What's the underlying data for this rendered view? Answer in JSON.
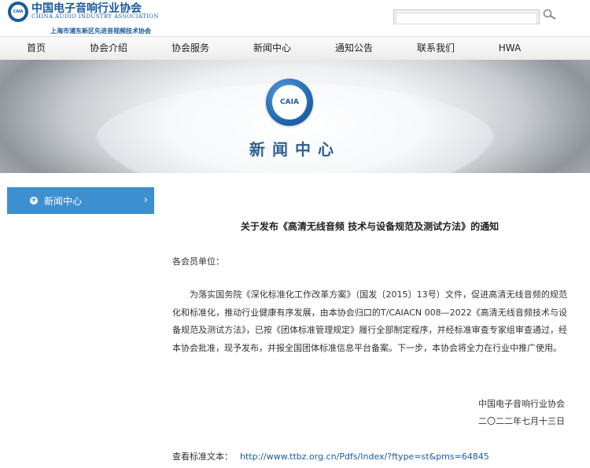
{
  "header": {
    "org_name_cn": "中国电子音响行业协会",
    "org_name_en": "CHINA AUDIO INDUSTRY ASSOCIATION",
    "org_subtitle": "上海市浦东新区先进音视频技术协会",
    "logo_text": "CAIA",
    "search": {
      "value": "",
      "placeholder": ""
    }
  },
  "nav": {
    "items": [
      {
        "label": "首页"
      },
      {
        "label": "协会介绍"
      },
      {
        "label": "协会服务"
      },
      {
        "label": "新闻中心"
      },
      {
        "label": "通知公告"
      },
      {
        "label": "联系我们"
      },
      {
        "label": "HWA"
      }
    ]
  },
  "banner": {
    "logo_text": "CAIA",
    "title": "新闻中心"
  },
  "sidebar": {
    "items": [
      {
        "label": "新闻中心"
      }
    ]
  },
  "article": {
    "title": "关于发布《高清无线音频 技术与设备规范及测试方法》的通知",
    "greeting": "各会员单位：",
    "body": "为落实国务院《深化标准化工作改革方案》（国发〔2015〕13号）文件，促进高清无线音频的规范化和标准化，推动行业健康有序发展，由本协会归口的T/CAIACN 008—2022《高清无线音频技术与设备规范及测试方法》，已按《团体标准管理规定》履行全部制定程序，并经标准审查专家组审查通过，经本协会批准，现予发布，并报全国团体标准信息平台备案。下一步，本协会将全力在行业中推广使用。",
    "signature_org": "中国电子音响行业协会",
    "signature_date": "二〇二二年七月十三日",
    "link_label": "查看标准文本：",
    "link_url": "http://www.ttbz.org.cn/Pdfs/Index/?ftype=st&pms=64845"
  },
  "colors": {
    "brand": "#1a5a9c",
    "sidebar_active": "#3e8fd0",
    "banner_title": "#2f5f95"
  }
}
